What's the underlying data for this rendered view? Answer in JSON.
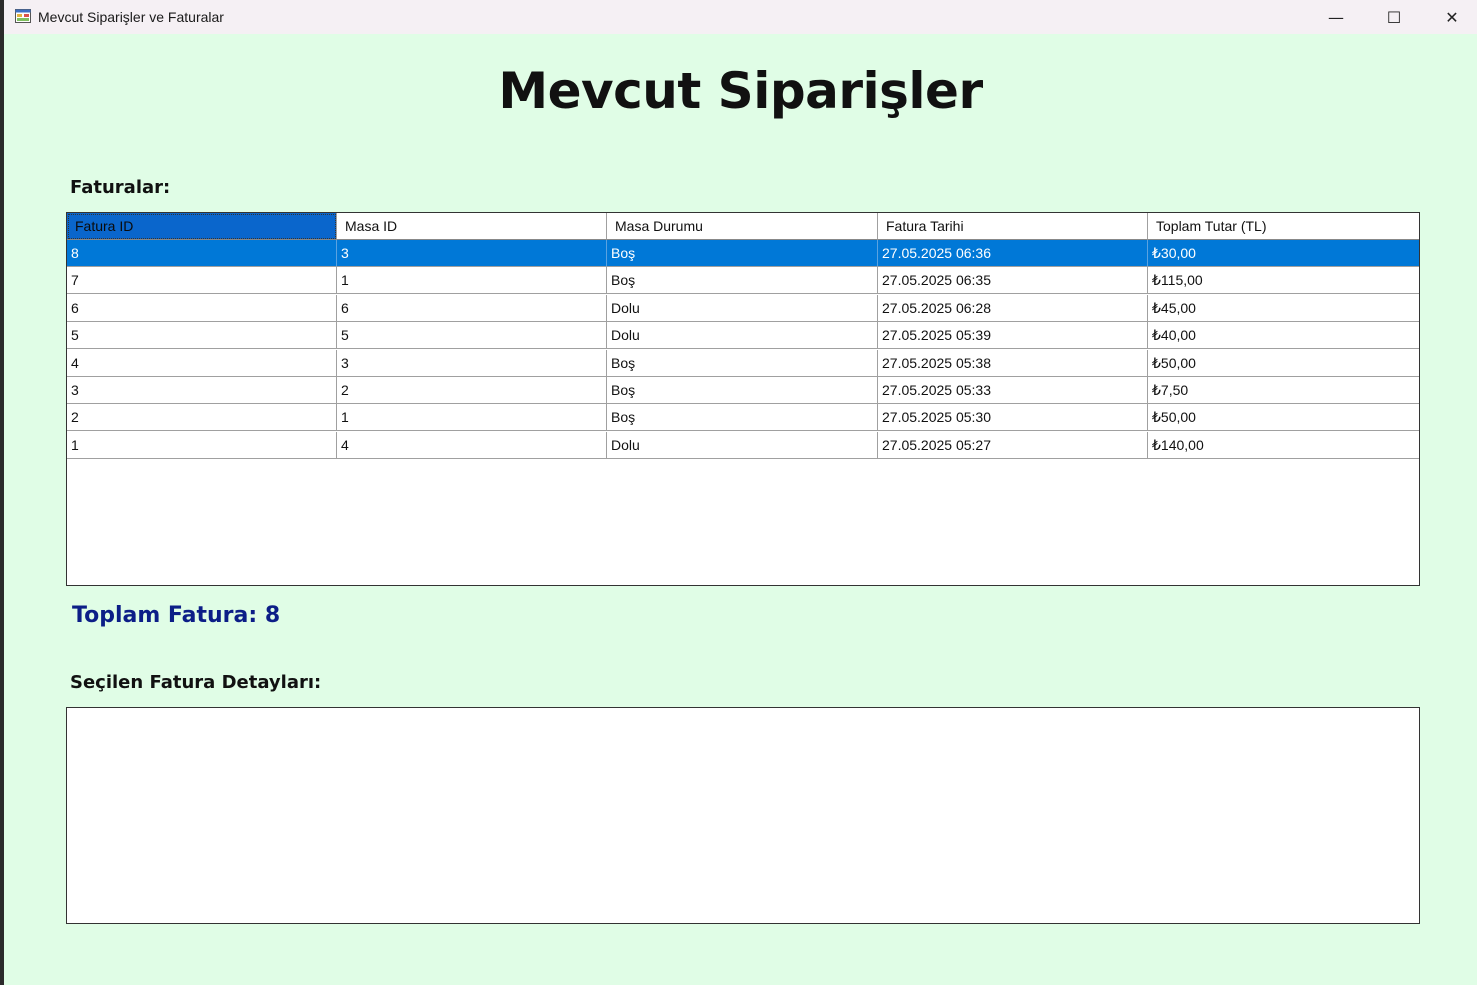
{
  "window": {
    "title": "Mevcut Siparişler ve Faturalar",
    "icons": {
      "app": "app-form-icon",
      "minimize": "minimize-icon",
      "maximize": "maximize-icon",
      "close": "close-icon"
    },
    "controls": {
      "minimize": "—",
      "maximize": "☐",
      "close": "✕"
    }
  },
  "main": {
    "title": "Mevcut Siparişler",
    "invoices_label": "Faturalar:",
    "total_label": "Toplam Fatura: 8",
    "details_label": "Seçilen Fatura Detayları:"
  },
  "table": {
    "columns": [
      "Fatura ID",
      "Masa ID",
      "Masa Durumu",
      "Fatura Tarihi",
      "Toplam Tutar (TL)"
    ],
    "selected_index": 0,
    "rows": [
      [
        "8",
        "3",
        "Boş",
        "27.05.2025 06:36",
        "₺30,00"
      ],
      [
        "7",
        "1",
        "Boş",
        "27.05.2025 06:35",
        "₺115,00"
      ],
      [
        "6",
        "6",
        "Dolu",
        "27.05.2025 06:28",
        "₺45,00"
      ],
      [
        "5",
        "5",
        "Dolu",
        "27.05.2025 05:39",
        "₺40,00"
      ],
      [
        "4",
        "3",
        "Boş",
        "27.05.2025 05:38",
        "₺50,00"
      ],
      [
        "3",
        "2",
        "Boş",
        "27.05.2025 05:33",
        "₺7,50"
      ],
      [
        "2",
        "1",
        "Boş",
        "27.05.2025 05:30",
        "₺50,00"
      ],
      [
        "1",
        "4",
        "Dolu",
        "27.05.2025 05:27",
        "₺140,00"
      ]
    ]
  },
  "details": {
    "text": ""
  },
  "colors": {
    "background": "#e0fde6",
    "selection": "#0078d7",
    "total_text": "#0c1e87"
  }
}
